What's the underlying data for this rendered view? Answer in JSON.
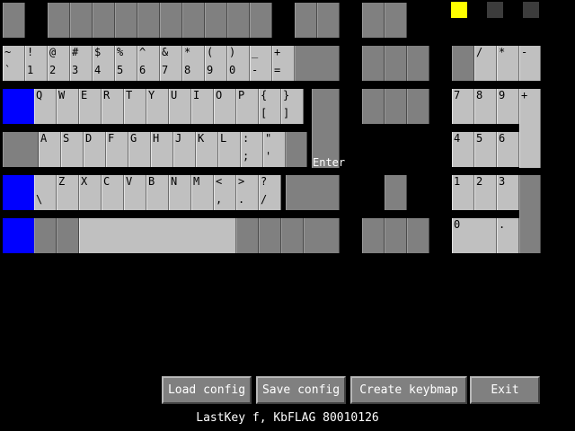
{
  "colors": {
    "key_light": "#c0c0c0",
    "key_dark": "#808080",
    "key_active": "#0000ff",
    "indicator_on": "#ffff00",
    "indicator_off": "#3c3c3c",
    "background": "#000000"
  },
  "keys": {
    "grave": {
      "top": "~",
      "bottom": "`"
    },
    "1": {
      "top": "!",
      "bottom": "1"
    },
    "2": {
      "top": "@",
      "bottom": "2"
    },
    "3": {
      "top": "#",
      "bottom": "3"
    },
    "4": {
      "top": "$",
      "bottom": "4"
    },
    "5": {
      "top": "%",
      "bottom": "5"
    },
    "6": {
      "top": "^",
      "bottom": "6"
    },
    "7": {
      "top": "&",
      "bottom": "7"
    },
    "8": {
      "top": "*",
      "bottom": "8"
    },
    "9": {
      "top": "(",
      "bottom": "9"
    },
    "0": {
      "top": ")",
      "bottom": "0"
    },
    "minus": {
      "top": "_",
      "bottom": "-"
    },
    "equals": {
      "top": "+",
      "bottom": "="
    },
    "q": {
      "top": "Q"
    },
    "w": {
      "top": "W"
    },
    "e": {
      "top": "E"
    },
    "r": {
      "top": "R"
    },
    "t": {
      "top": "T"
    },
    "y": {
      "top": "Y"
    },
    "u": {
      "top": "U"
    },
    "i": {
      "top": "I"
    },
    "o": {
      "top": "O"
    },
    "p": {
      "top": "P"
    },
    "lbracket": {
      "top": "{",
      "bottom": "["
    },
    "rbracket": {
      "top": "}",
      "bottom": "]"
    },
    "a": {
      "top": "A"
    },
    "s": {
      "top": "S"
    },
    "d": {
      "top": "D"
    },
    "f": {
      "top": "F"
    },
    "g": {
      "top": "G"
    },
    "h": {
      "top": "H"
    },
    "j": {
      "top": "J"
    },
    "k": {
      "top": "K"
    },
    "l": {
      "top": "L"
    },
    "semicolon": {
      "top": ":",
      "bottom": ";"
    },
    "quote": {
      "top": "\"",
      "bottom": "'"
    },
    "backslash": {
      "bottom": "\\"
    },
    "z": {
      "top": "Z"
    },
    "x": {
      "top": "X"
    },
    "c": {
      "top": "C"
    },
    "v": {
      "top": "V"
    },
    "b": {
      "top": "B"
    },
    "n": {
      "top": "N"
    },
    "m": {
      "top": "M"
    },
    "comma": {
      "top": "<",
      "bottom": ","
    },
    "period": {
      "top": ">",
      "bottom": "."
    },
    "slash": {
      "top": "?",
      "bottom": "/"
    },
    "kp_divide": {
      "top": "/"
    },
    "kp_multiply": {
      "top": "*"
    },
    "kp_minus": {
      "top": "-"
    },
    "kp7": {
      "top": "7"
    },
    "kp8": {
      "top": "8"
    },
    "kp9": {
      "top": "9"
    },
    "kp_plus": {
      "top": "+"
    },
    "kp4": {
      "top": "4"
    },
    "kp5": {
      "top": "5"
    },
    "kp6": {
      "top": "6"
    },
    "kp1": {
      "top": "1"
    },
    "kp2": {
      "top": "2"
    },
    "kp3": {
      "top": "3"
    },
    "kp0": {
      "top": "0"
    },
    "kp_decimal": {
      "top": "."
    }
  },
  "enter_label": "Enter",
  "buttons": {
    "load": "Load config",
    "save": "Save config",
    "create": "Create keybmap",
    "exit": "Exit"
  },
  "status": "LastKey f, KbFLAG 80010126"
}
